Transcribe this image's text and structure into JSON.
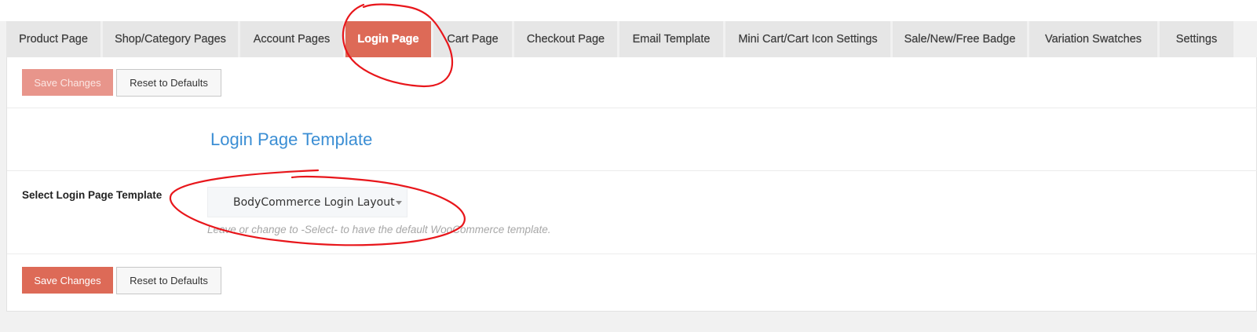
{
  "tabs": [
    {
      "label": "Product Page",
      "active": false
    },
    {
      "label": "Shop/Category Pages",
      "active": false
    },
    {
      "label": "Account Pages",
      "active": false
    },
    {
      "label": "Login Page",
      "active": true
    },
    {
      "label": "Cart Page",
      "active": false
    },
    {
      "label": "Checkout Page",
      "active": false
    },
    {
      "label": "Email Template",
      "active": false
    },
    {
      "label": "Mini Cart/Cart Icon Settings",
      "active": false
    },
    {
      "label": "Sale/New/Free Badge",
      "active": false
    },
    {
      "label": "Variation Swatches",
      "active": false
    },
    {
      "label": "Settings",
      "active": false
    }
  ],
  "top_buttons": {
    "save_label": "Save Changes",
    "save_state": "disabled",
    "reset_label": "Reset to Defaults"
  },
  "section": {
    "title": "Login Page Template"
  },
  "field": {
    "label": "Select Login Page Template",
    "selected_value": "BodyCommerce Login Layout",
    "hint": "Leave or change to -Select- to have the default WooCommerce template."
  },
  "bottom_buttons": {
    "save_label": "Save Changes",
    "reset_label": "Reset to Defaults"
  },
  "colors": {
    "accent": "#dd6a57",
    "accent_disabled": "#e8958b",
    "title_blue": "#3b8ed4",
    "annotation_red": "#e8161b",
    "tab_bg": "#e6e6e6"
  }
}
